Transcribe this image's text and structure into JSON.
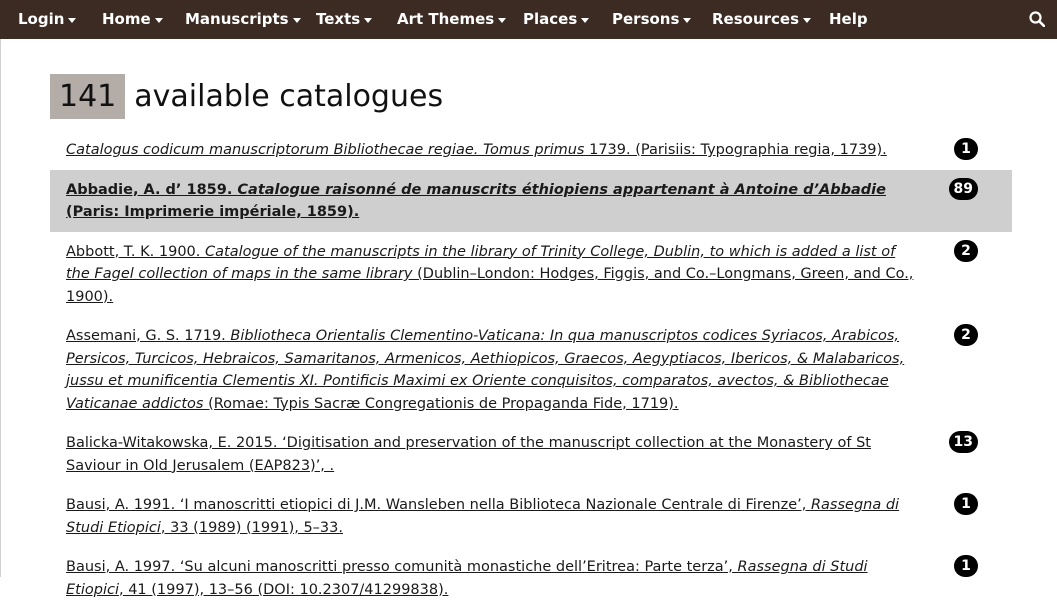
{
  "nav": {
    "items": [
      {
        "label": "Login",
        "caret": true
      },
      {
        "label": "Home",
        "caret": true
      },
      {
        "label": "Manuscripts",
        "caret": true
      },
      {
        "label": "Texts",
        "caret": true
      },
      {
        "label": "Art Themes",
        "caret": true
      },
      {
        "label": "Places",
        "caret": true
      },
      {
        "label": "Persons",
        "caret": true
      },
      {
        "label": "Resources",
        "caret": true
      },
      {
        "label": "Help",
        "caret": false
      }
    ],
    "search_icon": "search-icon"
  },
  "heading": {
    "count": "141",
    "label": "available catalogues"
  },
  "colors": {
    "navbar": "#3b2b22",
    "count_box": "#b3aca7",
    "highlight_row": "#cfcfcf",
    "badge": "#000000"
  },
  "catalogues": [
    {
      "parts": [
        {
          "t": "Catalogus codicum manuscriptorum  Bibliothecae regiae. Tomus primus",
          "i": true
        },
        {
          "t": " 1739. (Parisiis: Typographia regia, 1739).",
          "i": false
        }
      ],
      "count": "1",
      "highlighted": false
    },
    {
      "parts": [
        {
          "t": "Abbadie, A. d’ 1859. ",
          "i": false
        },
        {
          "t": "Catalogue raisonné de manuscrits éthiopiens appartenant à Antoine d’Abbadie",
          "i": true
        },
        {
          "t": " (Paris: Imprimerie impériale, 1859).",
          "i": false
        }
      ],
      "count": "89",
      "highlighted": true
    },
    {
      "parts": [
        {
          "t": "Abbott, T. K. 1900. ",
          "i": false
        },
        {
          "t": "Catalogue of the manuscripts in the library of Trinity College, Dublin, to which is added a list of the Fagel collection of maps in the same library",
          "i": true
        },
        {
          "t": " (Dublin–London: Hodges, Figgis, and Co.–Longmans, Green, and Co., 1900).",
          "i": false
        }
      ],
      "count": "2",
      "highlighted": false
    },
    {
      "parts": [
        {
          "t": "Assemani, G. S. 1719. ",
          "i": false
        },
        {
          "t": "Bibliotheca Orientalis Clementino-Vaticana: In qua manuscriptos codices Syriacos, Arabicos, Persicos, Turcicos, Hebraicos, Samaritanos, Armenicos, Aethiopicos, Graecos, Aegyptiacos, Ibericos, & Malabaricos, jussu et munificentia Clementis XI. Pontificis Maximi ex Oriente conquisitos, comparatos, avectos, & Bibliothecae Vaticanae addictos",
          "i": true
        },
        {
          "t": " (Romae: Typis Sacræ Congregationis de Propaganda Fide, 1719).",
          "i": false
        }
      ],
      "count": "2",
      "highlighted": false
    },
    {
      "parts": [
        {
          "t": "Balicka-Witakowska, E. 2015. ‘Digitisation and preservation of the manuscript collection at the Monastery of St Saviour in Old Jerusalem (EAP823)’, .",
          "i": false
        }
      ],
      "count": "13",
      "highlighted": false
    },
    {
      "parts": [
        {
          "t": "Bausi, A. 1991. ‘I manoscritti etiopici di J.M. Wansleben nella Biblioteca Nazionale Centrale di Firenze’, ",
          "i": false
        },
        {
          "t": "Rassegna di Studi Etiopici",
          "i": true
        },
        {
          "t": ", 33 (1989) (1991), 5–33.",
          "i": false
        }
      ],
      "count": "1",
      "highlighted": false
    },
    {
      "parts": [
        {
          "t": "Bausi, A. 1997. ‘Su alcuni manoscritti presso comunità monastiche dell’Eritrea: Parte terza’, ",
          "i": false
        },
        {
          "t": "Rassegna di Studi Etiopici",
          "i": true
        },
        {
          "t": ", 41 (1997), 13–56 (DOI: 10.2307/41299838).",
          "i": false
        }
      ],
      "count": "1",
      "highlighted": false
    }
  ]
}
